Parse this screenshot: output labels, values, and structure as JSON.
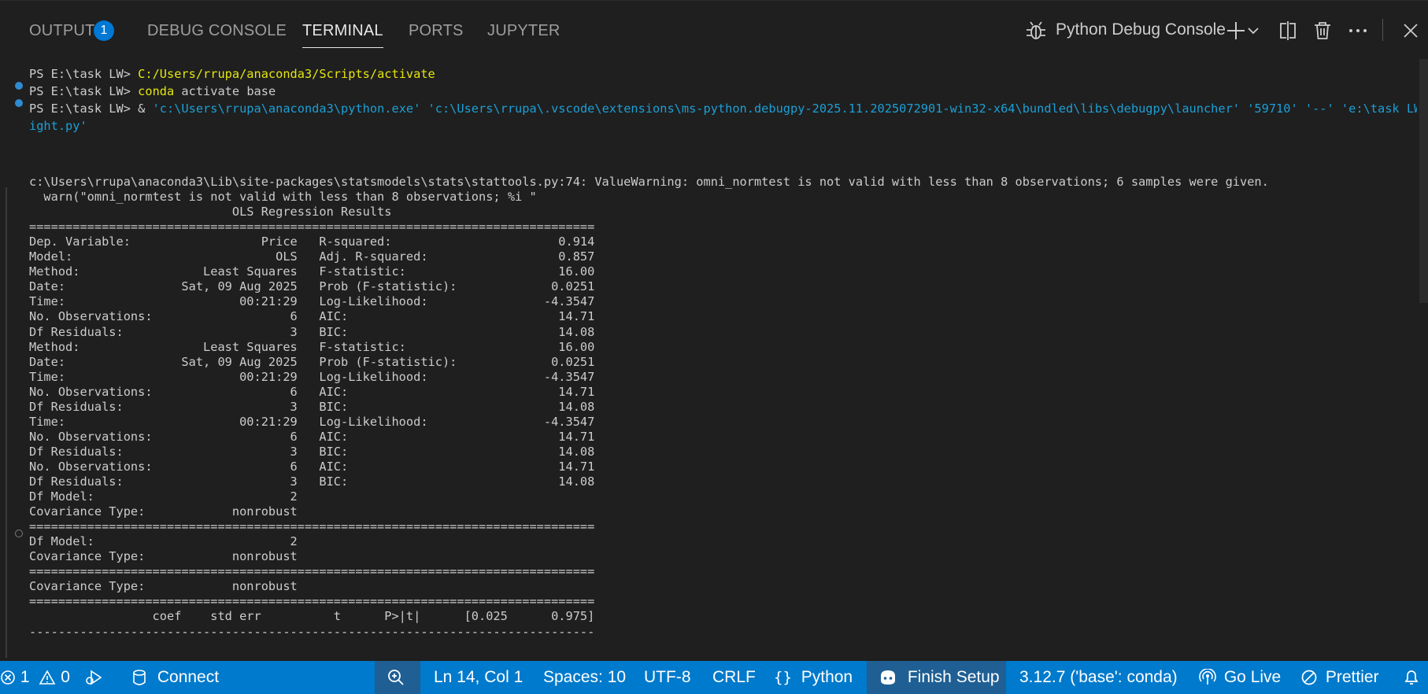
{
  "panel": {
    "tabs": [
      {
        "label": "OUTPUT",
        "badge": "1"
      },
      {
        "label": "DEBUG CONSOLE"
      },
      {
        "label": "TERMINAL",
        "active": true
      },
      {
        "label": "PORTS"
      },
      {
        "label": "JUPYTER"
      }
    ],
    "terminal_selector_label": "Python Debug Console",
    "icons": [
      "bug-icon",
      "plus-icon",
      "chevron-down-icon",
      "split-icon",
      "trash-icon",
      "more-icon",
      "close-icon"
    ]
  },
  "terminal": {
    "prompt": "PS E:\\task LW>",
    "commands": [
      {
        "text_a": "C:/Users/rrupa/anaconda3/Scripts/activate",
        "text_b": ""
      },
      {
        "text_a": "conda",
        "text_b": " activate base"
      },
      {
        "amp": " & ",
        "exe": "'c:\\Users\\rrupa\\anaconda3\\python.exe' 'c:\\Users\\rrupa\\.vscode\\extensions\\ms-python.debugpy-2025.11.2025072901-win32-x64\\bundled\\libs\\debugpy\\launcher' '59710' '--' 'e:\\task LW\\we",
        "wrap": "ight.py'"
      }
    ],
    "output_lines": [
      "c:\\Users\\rrupa\\anaconda3\\Lib\\site-packages\\statsmodels\\stats\\stattools.py:74: ValueWarning: omni_normtest is not valid with less than 8 observations; 6 samples were given.",
      "  warn(\"omni_normtest is not valid with less than 8 observations; %i \"",
      "                            OLS Regression Results",
      "==============================================================================",
      "Dep. Variable:                  Price   R-squared:                       0.914",
      "Model:                            OLS   Adj. R-squared:                  0.857",
      "Method:                 Least Squares   F-statistic:                     16.00",
      "Date:                Sat, 09 Aug 2025   Prob (F-statistic):             0.0251",
      "Time:                        00:21:29   Log-Likelihood:                -4.3547",
      "No. Observations:                   6   AIC:                             14.71",
      "Df Residuals:                       3   BIC:                             14.08",
      "Method:                 Least Squares   F-statistic:                     16.00",
      "Date:                Sat, 09 Aug 2025   Prob (F-statistic):             0.0251",
      "Time:                        00:21:29   Log-Likelihood:                -4.3547",
      "No. Observations:                   6   AIC:                             14.71",
      "Df Residuals:                       3   BIC:                             14.08",
      "Time:                        00:21:29   Log-Likelihood:                -4.3547",
      "No. Observations:                   6   AIC:                             14.71",
      "Df Residuals:                       3   BIC:                             14.08",
      "No. Observations:                   6   AIC:                             14.71",
      "Df Residuals:                       3   BIC:                             14.08",
      "Df Model:                           2",
      "Covariance Type:            nonrobust",
      "==============================================================================",
      "Df Model:                           2",
      "Covariance Type:            nonrobust",
      "==============================================================================",
      "Covariance Type:            nonrobust",
      "==============================================================================",
      "                 coef    std err          t      P>|t|      [0.025      0.975]",
      "------------------------------------------------------------------------------"
    ]
  },
  "statusbar": {
    "errors": "1",
    "warnings": "0",
    "connect": "Connect",
    "search": "",
    "position": "Ln 14, Col 1",
    "spaces": "Spaces: 10",
    "encoding": "UTF-8",
    "eol": "CRLF",
    "language": "Python",
    "finish_setup": "Finish Setup",
    "interpreter": "3.12.7 ('base': conda)",
    "golive": "Go Live",
    "prettier": "Prettier"
  }
}
